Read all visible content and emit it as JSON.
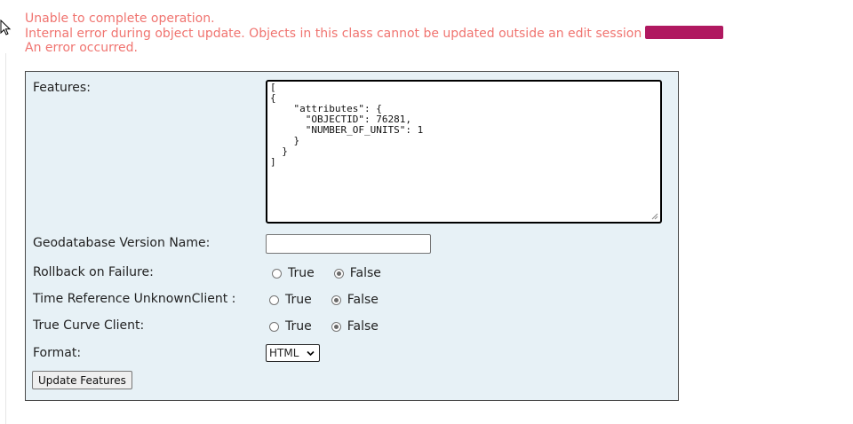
{
  "errors": {
    "line1": "Unable to complete operation.",
    "line2": "Internal error during object update. Objects in this class cannot be updated outside an edit session",
    "line3": "An error occurred.",
    "redaction_color": "#b01860"
  },
  "form": {
    "features_label": "Features:",
    "features_value": "[\n{\n    \"attributes\": {\n      \"OBJECTID\": 76281,\n      \"NUMBER_OF_UNITS\": 1\n    }\n  }\n]",
    "gdb_version_label": "Geodatabase Version Name:",
    "gdb_version_value": "",
    "rollback_label": "Rollback on Failure:",
    "time_ref_label": "Time Reference UnknownClient :",
    "true_curve_label": "True Curve Client:",
    "true_option": "True",
    "false_option": "False",
    "rollback_selected": "False",
    "time_ref_selected": "False",
    "true_curve_selected": "False",
    "format_label": "Format:",
    "format_value": "HTML",
    "submit_label": "Update Features"
  },
  "colors": {
    "error_text": "#f07470",
    "panel_bg": "#e7f1f6",
    "panel_border": "#4a4a4a"
  }
}
